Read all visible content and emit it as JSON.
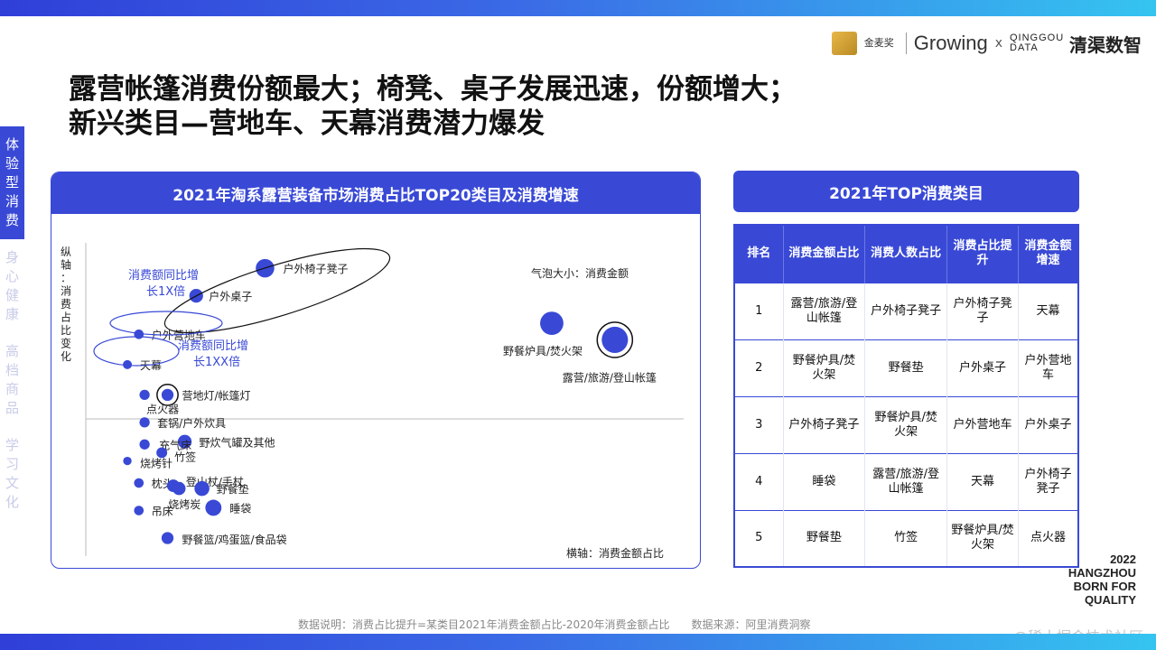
{
  "brand": {
    "logo1": "金麦奖",
    "logo2": "Growing",
    "logo_x": "x",
    "logo3": "QINGGOU DATA",
    "logo4": "清渠数智"
  },
  "title": {
    "line1": "露营帐篷消费份额最大；椅凳、桌子发展迅速，份额增大；",
    "line2": "新兴类目—营地车、天幕消费潜力爆发"
  },
  "side_nav": [
    {
      "label": "体验型消费",
      "active": true
    },
    {
      "label": "身心健康",
      "active": false
    },
    {
      "label": "高档商品",
      "active": false
    },
    {
      "label": "学习文化",
      "active": false
    }
  ],
  "left_panel": {
    "header": "2021年淘系露营装备市场消费占比TOP20类目及消费增速"
  },
  "chart_data": {
    "type": "scatter",
    "title": "2021年淘系露营装备市场消费占比TOP20类目及消费增速",
    "ylabel": "纵轴：消费占比变化",
    "xlabel": "横轴：消费金额占比",
    "size_note": "气泡大小：消费金额",
    "note_growth_1x": "消费额同比增长1X倍",
    "note_growth_1xx": "消费额同比增长1XX倍",
    "accent": "#3949d6",
    "points": [
      {
        "name": "户外椅子凳子",
        "x": 0.27,
        "y": 0.93,
        "size": 2.2,
        "circled": true
      },
      {
        "name": "户外桌子",
        "x": 0.15,
        "y": 0.83,
        "size": 1.4,
        "circled": true
      },
      {
        "name": "户外营地车",
        "x": 0.05,
        "y": 0.69,
        "size": 0.7,
        "circled": true
      },
      {
        "name": "天幕",
        "x": 0.03,
        "y": 0.58,
        "size": 0.6,
        "circled": true
      },
      {
        "name": "营地灯/帐篷灯",
        "x": 0.1,
        "y": 0.47,
        "size": 1.1,
        "circled": true
      },
      {
        "name": "点火器",
        "x": 0.06,
        "y": 0.47,
        "size": 0.8
      },
      {
        "name": "套锅/户外炊具",
        "x": 0.06,
        "y": 0.37,
        "size": 0.8
      },
      {
        "name": "野炊气罐及其他",
        "x": 0.13,
        "y": 0.3,
        "size": 1.4
      },
      {
        "name": "充气床",
        "x": 0.06,
        "y": 0.29,
        "size": 0.8
      },
      {
        "name": "竹签",
        "x": 0.09,
        "y": 0.26,
        "size": 0.9
      },
      {
        "name": "烧烤针",
        "x": 0.03,
        "y": 0.23,
        "size": 0.5
      },
      {
        "name": "枕头",
        "x": 0.05,
        "y": 0.15,
        "size": 0.7
      },
      {
        "name": "登山杖/手杖",
        "x": 0.11,
        "y": 0.14,
        "size": 1.2
      },
      {
        "name": "烧烤炭",
        "x": 0.12,
        "y": 0.13,
        "size": 1.3
      },
      {
        "name": "野餐垫",
        "x": 0.16,
        "y": 0.13,
        "size": 1.6
      },
      {
        "name": "睡袋",
        "x": 0.18,
        "y": 0.06,
        "size": 1.8
      },
      {
        "name": "吊床",
        "x": 0.05,
        "y": 0.05,
        "size": 0.7
      },
      {
        "name": "野餐篮/鸡蛋篮/食品袋",
        "x": 0.1,
        "y": -0.05,
        "size": 1.1
      },
      {
        "name": "野餐炉具/焚火架",
        "x": 0.77,
        "y": 0.73,
        "size": 3.0
      },
      {
        "name": "露营/旅游/登山帐篷",
        "x": 0.88,
        "y": 0.67,
        "size": 3.5,
        "circled": true
      }
    ]
  },
  "right_panel": {
    "header": "2021年TOP消费类目",
    "columns": [
      "排名",
      "消费金额占比",
      "消费人数占比",
      "消费占比提升",
      "消费金额增速"
    ],
    "rows": [
      [
        "1",
        "露营/旅游/登山帐篷",
        "户外椅子凳子",
        "户外椅子凳子",
        "天幕"
      ],
      [
        "2",
        "野餐炉具/焚火架",
        "野餐垫",
        "户外桌子",
        "户外营地车"
      ],
      [
        "3",
        "户外椅子凳子",
        "野餐炉具/焚火架",
        "户外营地车",
        "户外桌子"
      ],
      [
        "4",
        "睡袋",
        "露营/旅游/登山帐篷",
        "天幕",
        "户外椅子凳子"
      ],
      [
        "5",
        "野餐垫",
        "竹签",
        "野餐炉具/焚火架",
        "点火器"
      ]
    ]
  },
  "tagline": [
    "2022",
    "HANGZHOU",
    "BORN FOR",
    "QUALITY"
  ],
  "footer": {
    "note": "数据说明：消费占比提升=某类目2021年消费金额占比-2020年消费金额占比",
    "source": "数据来源：阿里消费洞察",
    "watermark": "@稀土掘金技术社区"
  }
}
